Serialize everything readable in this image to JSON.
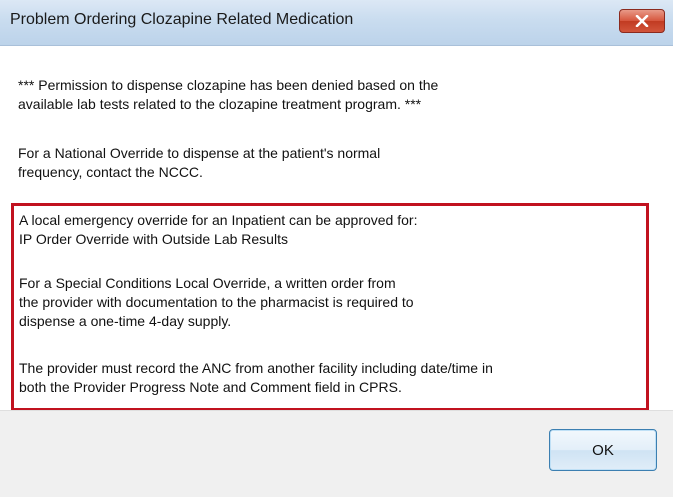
{
  "window": {
    "title": "Problem Ordering Clozapine Related Medication",
    "close_icon": "close-icon",
    "close_color": "#c13b22"
  },
  "message": {
    "paragraph1": [
      "*** Permission to dispense clozapine has been denied based on the",
      "available lab tests related to the clozapine treatment program. ***"
    ],
    "paragraph2": [
      "For a National Override to dispense at the patient's normal",
      "frequency, contact the NCCC."
    ],
    "highlight_color": "#c1121f",
    "highlight": {
      "paragraph1": [
        "A local emergency override for an Inpatient can be approved for:",
        "IP Order Override with Outside Lab Results"
      ],
      "paragraph2": [
        "For a Special Conditions Local Override, a written order from",
        "the provider with documentation to the pharmacist is required to",
        "dispense a one-time 4-day supply."
      ],
      "paragraph3": [
        "The provider must record the ANC from another facility including date/time in",
        "both the Provider Progress Note and Comment field in CPRS."
      ]
    }
  },
  "buttons": {
    "ok_label": "OK"
  }
}
